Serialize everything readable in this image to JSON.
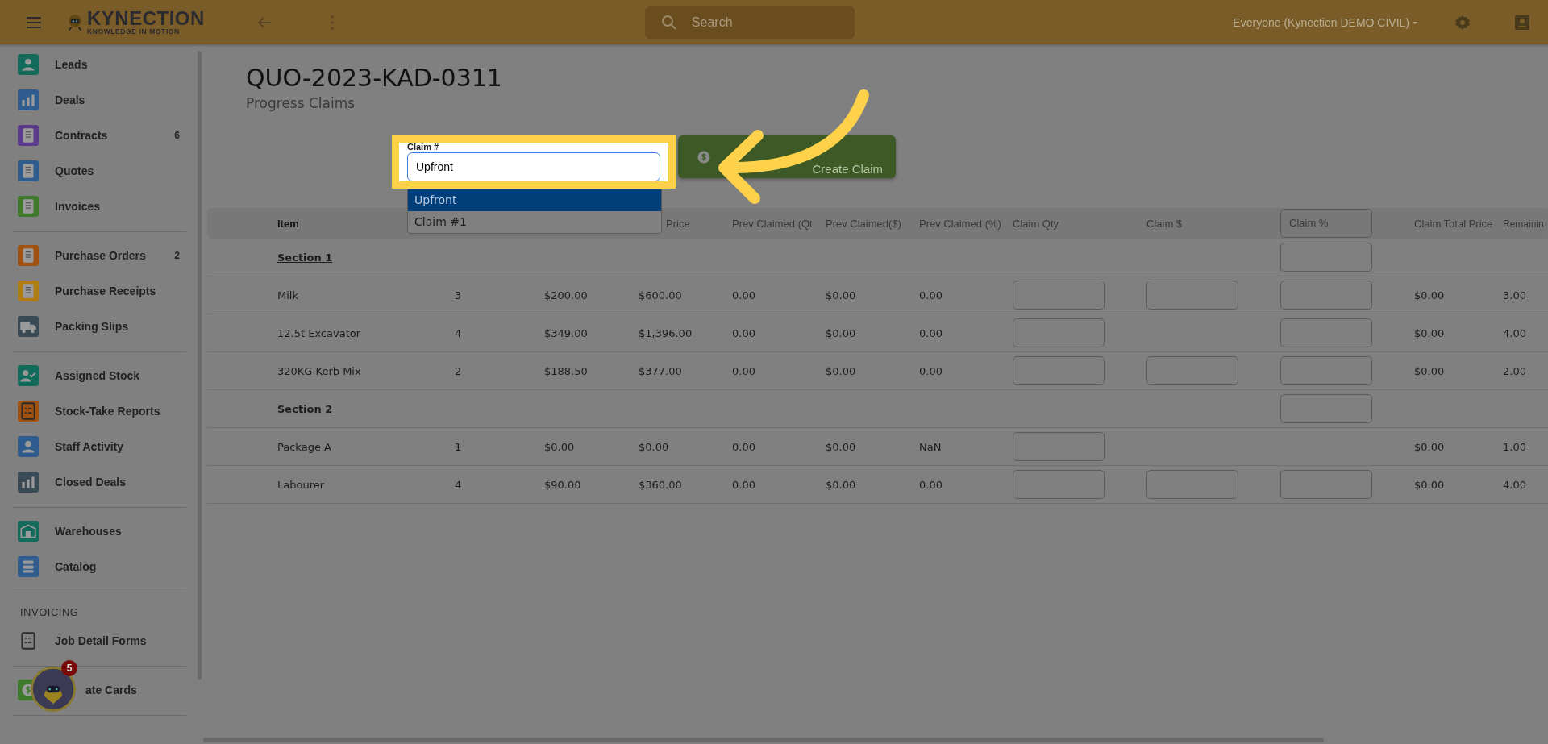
{
  "topbar": {
    "logo_title": "KYNECTION",
    "logo_tagline": "KNOWLEDGE IN MOTION",
    "search": {
      "placeholder": "Search"
    },
    "account": "Everyone (Kynection DEMO CIVIL)"
  },
  "sidebar": {
    "groups": [
      {
        "items": [
          {
            "label": "Leads",
            "color": "#136b5c"
          },
          {
            "label": "Deals",
            "color": "#2f5c8f"
          },
          {
            "label": "Contracts",
            "color": "#5a3a8a",
            "count": "6"
          },
          {
            "label": "Quotes",
            "color": "#2f5c8f"
          },
          {
            "label": "Invoices",
            "color": "#3f7a2a"
          }
        ]
      },
      {
        "items": [
          {
            "label": "Purchase Orders",
            "color": "#a0500f",
            "count": "2"
          },
          {
            "label": "Purchase Receipts",
            "color": "#b07d10"
          },
          {
            "label": "Packing Slips",
            "color": "#3a4a55"
          }
        ]
      },
      {
        "items": [
          {
            "label": "Assigned Stock",
            "color": "#136b5c"
          },
          {
            "label": "Stock-Take Reports",
            "color": "#a0500f"
          },
          {
            "label": "Staff Activity",
            "color": "#2f5c8f"
          },
          {
            "label": "Closed Deals",
            "color": "#3a4a55"
          }
        ]
      },
      {
        "items": [
          {
            "label": "Warehouses",
            "color": "#136b5c"
          },
          {
            "label": "Catalog",
            "color": "#2f5c8f"
          }
        ]
      },
      {
        "heading": "INVOICING",
        "items": [
          {
            "label": "Job Detail Forms"
          }
        ]
      },
      {
        "items": [
          {
            "label": "ate Cards",
            "color": "#3f7a2a"
          }
        ]
      }
    ]
  },
  "assistant_badge": "5",
  "page": {
    "title": "QUO-2023-KAD-0311",
    "subtitle": "Progress Claims"
  },
  "claim_field": {
    "label": "Claim #",
    "value": "Upfront",
    "options": [
      {
        "label": "Upfront",
        "selected": true
      },
      {
        "label": "Claim #1",
        "selected": false
      }
    ]
  },
  "create_button": "Create Claim",
  "table": {
    "columns": [
      "Item",
      "Price",
      "Prev Claimed (Qt",
      "Prev Claimed($)",
      "Prev Claimed (%)",
      "Claim Qty",
      "Claim $",
      "Claim %",
      "Claim Total Price",
      "Remainin"
    ],
    "rows": [
      {
        "kind": "section",
        "item": "Section 1",
        "pct_input": true
      },
      {
        "kind": "item",
        "item": "Milk",
        "qty": "3",
        "unit": "$200.00",
        "total": "$600.00",
        "prev_qty": "0.00",
        "prev_amount": "$0.00",
        "prev_pct": "0.00",
        "qty_input": true,
        "amount_input": true,
        "pct_input": true,
        "claim_total": "$0.00",
        "remaining": "3.00"
      },
      {
        "kind": "item",
        "item": "12.5t Excavator",
        "qty": "4",
        "unit": "$349.00",
        "total": "$1,396.00",
        "prev_qty": "0.00",
        "prev_amount": "$0.00",
        "prev_pct": "0.00",
        "qty_input": true,
        "amount_input": false,
        "pct_input": true,
        "claim_total": "$0.00",
        "remaining": "4.00"
      },
      {
        "kind": "item",
        "item": "320KG Kerb Mix",
        "qty": "2",
        "unit": "$188.50",
        "total": "$377.00",
        "prev_qty": "0.00",
        "prev_amount": "$0.00",
        "prev_pct": "0.00",
        "qty_input": true,
        "amount_input": true,
        "pct_input": true,
        "claim_total": "$0.00",
        "remaining": "2.00"
      },
      {
        "kind": "section",
        "item": "Section 2",
        "pct_input": true
      },
      {
        "kind": "item",
        "item": "Package A",
        "qty": "1",
        "unit": "$0.00",
        "total": "$0.00",
        "prev_qty": "0.00",
        "prev_amount": "$0.00",
        "prev_pct": "NaN",
        "qty_input": true,
        "amount_input": false,
        "pct_input": false,
        "claim_total": "$0.00",
        "remaining": "1.00"
      },
      {
        "kind": "item",
        "item": "Labourer",
        "qty": "4",
        "unit": "$90.00",
        "total": "$360.00",
        "prev_qty": "0.00",
        "prev_amount": "$0.00",
        "prev_pct": "0.00",
        "qty_input": true,
        "amount_input": true,
        "pct_input": true,
        "claim_total": "$0.00",
        "remaining": "4.00"
      }
    ]
  }
}
